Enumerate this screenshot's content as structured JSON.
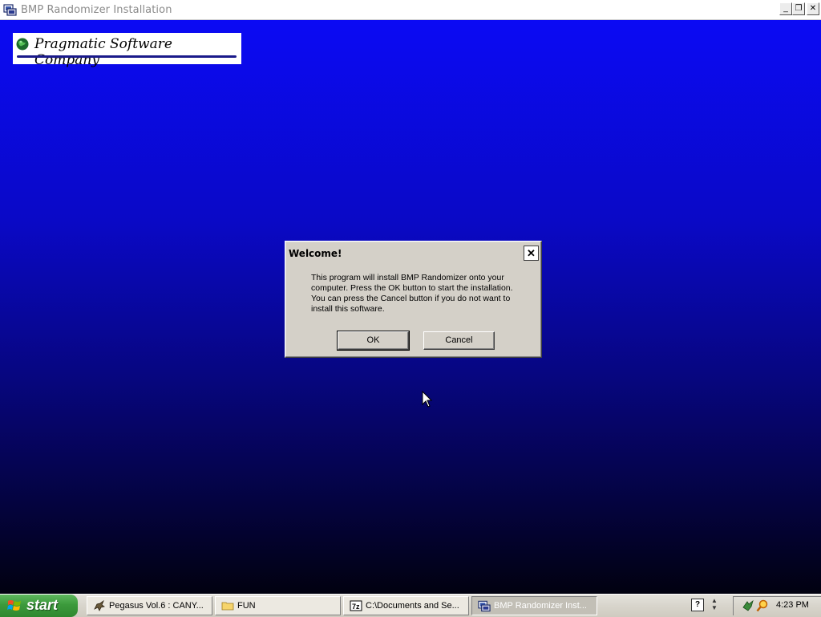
{
  "window": {
    "title": "BMP Randomizer Installation",
    "minimize_glyph": "_",
    "maximize_glyph": "❐",
    "close_glyph": "✕"
  },
  "branding": {
    "company_name": "Pragmatic Software Company",
    "icon": "globe-icon"
  },
  "dialog": {
    "title": "Welcome!",
    "close_glyph": "✕",
    "message": "This program will install BMP Randomizer onto your computer. Press the OK button to start the installation. You can press the Cancel button if you do not want to install this software.",
    "ok_label": "OK",
    "cancel_label": "Cancel"
  },
  "taskbar": {
    "start_label": "start",
    "tasks": [
      {
        "label": "Pegasus Vol.6 : CANY...",
        "icon": "pegasus-icon",
        "active": false
      },
      {
        "label": "FUN",
        "icon": "folder-icon",
        "active": false
      },
      {
        "label": "C:\\Documents and Se...",
        "icon": "7zip-icon",
        "active": false
      },
      {
        "label": "BMP Randomizer Inst...",
        "icon": "installer-icon",
        "active": true
      }
    ],
    "help_glyph": "?",
    "clock": "4:23 PM"
  },
  "colors": {
    "gradient_top": "#0b0af4",
    "gradient_bottom": "#010110",
    "dialog_face": "#d4d0c8",
    "taskbar": "#d8d5cc",
    "start_green": "#3c9a3c"
  }
}
